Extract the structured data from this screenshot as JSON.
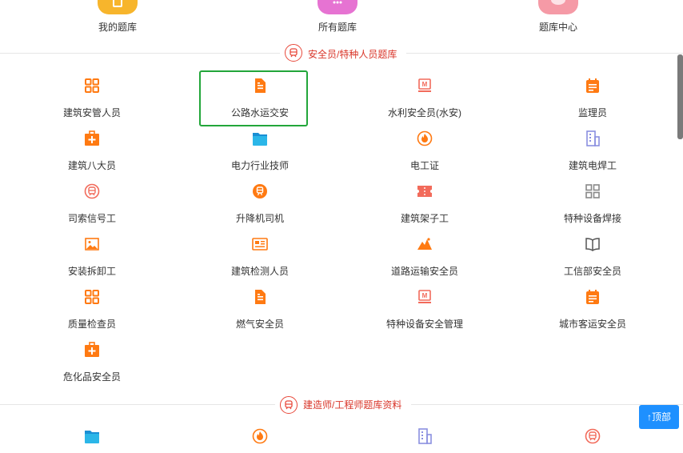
{
  "top_items": [
    {
      "label": "我的题库",
      "color": "#f7b52c"
    },
    {
      "label": "所有题库",
      "color": "#e673d2"
    },
    {
      "label": "题库中心",
      "color": "#f59aa6"
    }
  ],
  "section1": {
    "title": "安全员/特种人员题库",
    "accent": "#e8483a"
  },
  "section2": {
    "title": "建造师/工程师题库资料",
    "accent": "#e8483a"
  },
  "grid": [
    {
      "label": "建筑安管人员",
      "icon": "grid-icon"
    },
    {
      "label": "公路水运交安",
      "icon": "document-icon"
    },
    {
      "label": "水利安全员(水安)",
      "icon": "m-card-icon"
    },
    {
      "label": "监理员",
      "icon": "calendar-icon"
    },
    {
      "label": "建筑八大员",
      "icon": "medical-kit-icon"
    },
    {
      "label": "电力行业技师",
      "icon": "folder-icon"
    },
    {
      "label": "电工证",
      "icon": "fire-icon"
    },
    {
      "label": "建筑电焊工",
      "icon": "building-icon"
    },
    {
      "label": "司索信号工",
      "icon": "train-icon"
    },
    {
      "label": "升降机司机",
      "icon": "train-coin-icon"
    },
    {
      "label": "建筑架子工",
      "icon": "ticket-icon"
    },
    {
      "label": "特种设备焊接",
      "icon": "grid-outline-icon"
    },
    {
      "label": "安装拆卸工",
      "icon": "picture-icon"
    },
    {
      "label": "建筑检测人员",
      "icon": "id-card-icon"
    },
    {
      "label": "道路运输安全员",
      "icon": "mountain-icon"
    },
    {
      "label": "工信部安全员",
      "icon": "book-icon"
    },
    {
      "label": "质量检查员",
      "icon": "grid-icon"
    },
    {
      "label": "燃气安全员",
      "icon": "document-icon"
    },
    {
      "label": "特种设备安全管理",
      "icon": "m-card-icon"
    },
    {
      "label": "城市客运安全员",
      "icon": "calendar-icon"
    },
    {
      "label": "危化品安全员",
      "icon": "medical-kit-icon"
    }
  ],
  "selected_index": 1,
  "bottom_icons": [
    "folder-icon",
    "fire-icon",
    "building-icon",
    "train-icon"
  ],
  "back_to_top": {
    "label": "↑顶部",
    "color": "#1e90ff"
  },
  "colors": {
    "orange": "#ff7a12",
    "salmon": "#f26b5b",
    "blue": "#2bb6e8",
    "purple": "#8a8fe0",
    "gray": "#888888",
    "select": "#22a63a"
  }
}
